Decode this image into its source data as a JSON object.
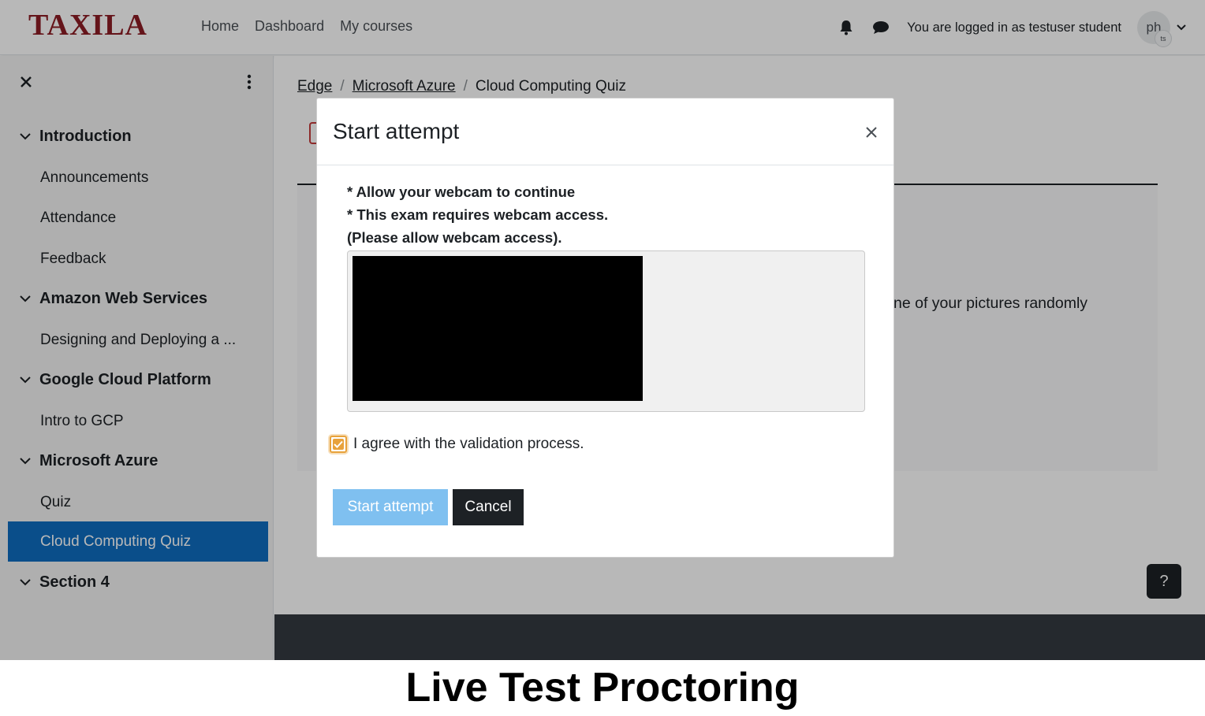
{
  "brand": {
    "name": "TAXILA",
    "color": "#8c1d24"
  },
  "nav": {
    "links": [
      "Home",
      "Dashboard",
      "My courses"
    ],
    "login_text": "You are logged in as testuser student",
    "avatar_initials": "ph",
    "avatar_sub": "ts",
    "icons": [
      "bell-icon",
      "chat-icon",
      "chevron-down-icon"
    ]
  },
  "sidebar": {
    "items": [
      {
        "label": "Introduction",
        "type": "section"
      },
      {
        "label": "Announcements",
        "type": "child"
      },
      {
        "label": "Attendance",
        "type": "child"
      },
      {
        "label": "Feedback",
        "type": "child"
      },
      {
        "label": "Amazon Web Services",
        "type": "section"
      },
      {
        "label": "Designing and Deploying a ...",
        "type": "child"
      },
      {
        "label": "Google Cloud Platform",
        "type": "section"
      },
      {
        "label": "Intro to GCP",
        "type": "child"
      },
      {
        "label": "Microsoft Azure",
        "type": "section"
      },
      {
        "label": "Quiz",
        "type": "child"
      },
      {
        "label": "Cloud Computing Quiz",
        "type": "child",
        "active": true
      },
      {
        "label": "Section 4",
        "type": "section"
      }
    ]
  },
  "breadcrumb": {
    "items": [
      "Edge",
      "Microsoft Azure"
    ],
    "current": "Cloud Computing Quiz",
    "separator": "/"
  },
  "main": {
    "partial_text": "ne of your pictures randomly",
    "help_label": "?"
  },
  "modal": {
    "title": "Start attempt",
    "close_symbol": "×",
    "notices": [
      "* Allow your webcam to continue",
      "* This exam requires webcam access.",
      "(Please allow webcam access)."
    ],
    "agree_label": "I agree with the validation process.",
    "agree_checked": true,
    "start_label": "Start attempt",
    "cancel_label": "Cancel"
  },
  "caption": "Live Test Proctoring",
  "colors": {
    "active": "#0f6cbf",
    "primary_button": "#7fc0f0",
    "dark_button": "#1d2125",
    "checkbox": "#e8a23b"
  }
}
